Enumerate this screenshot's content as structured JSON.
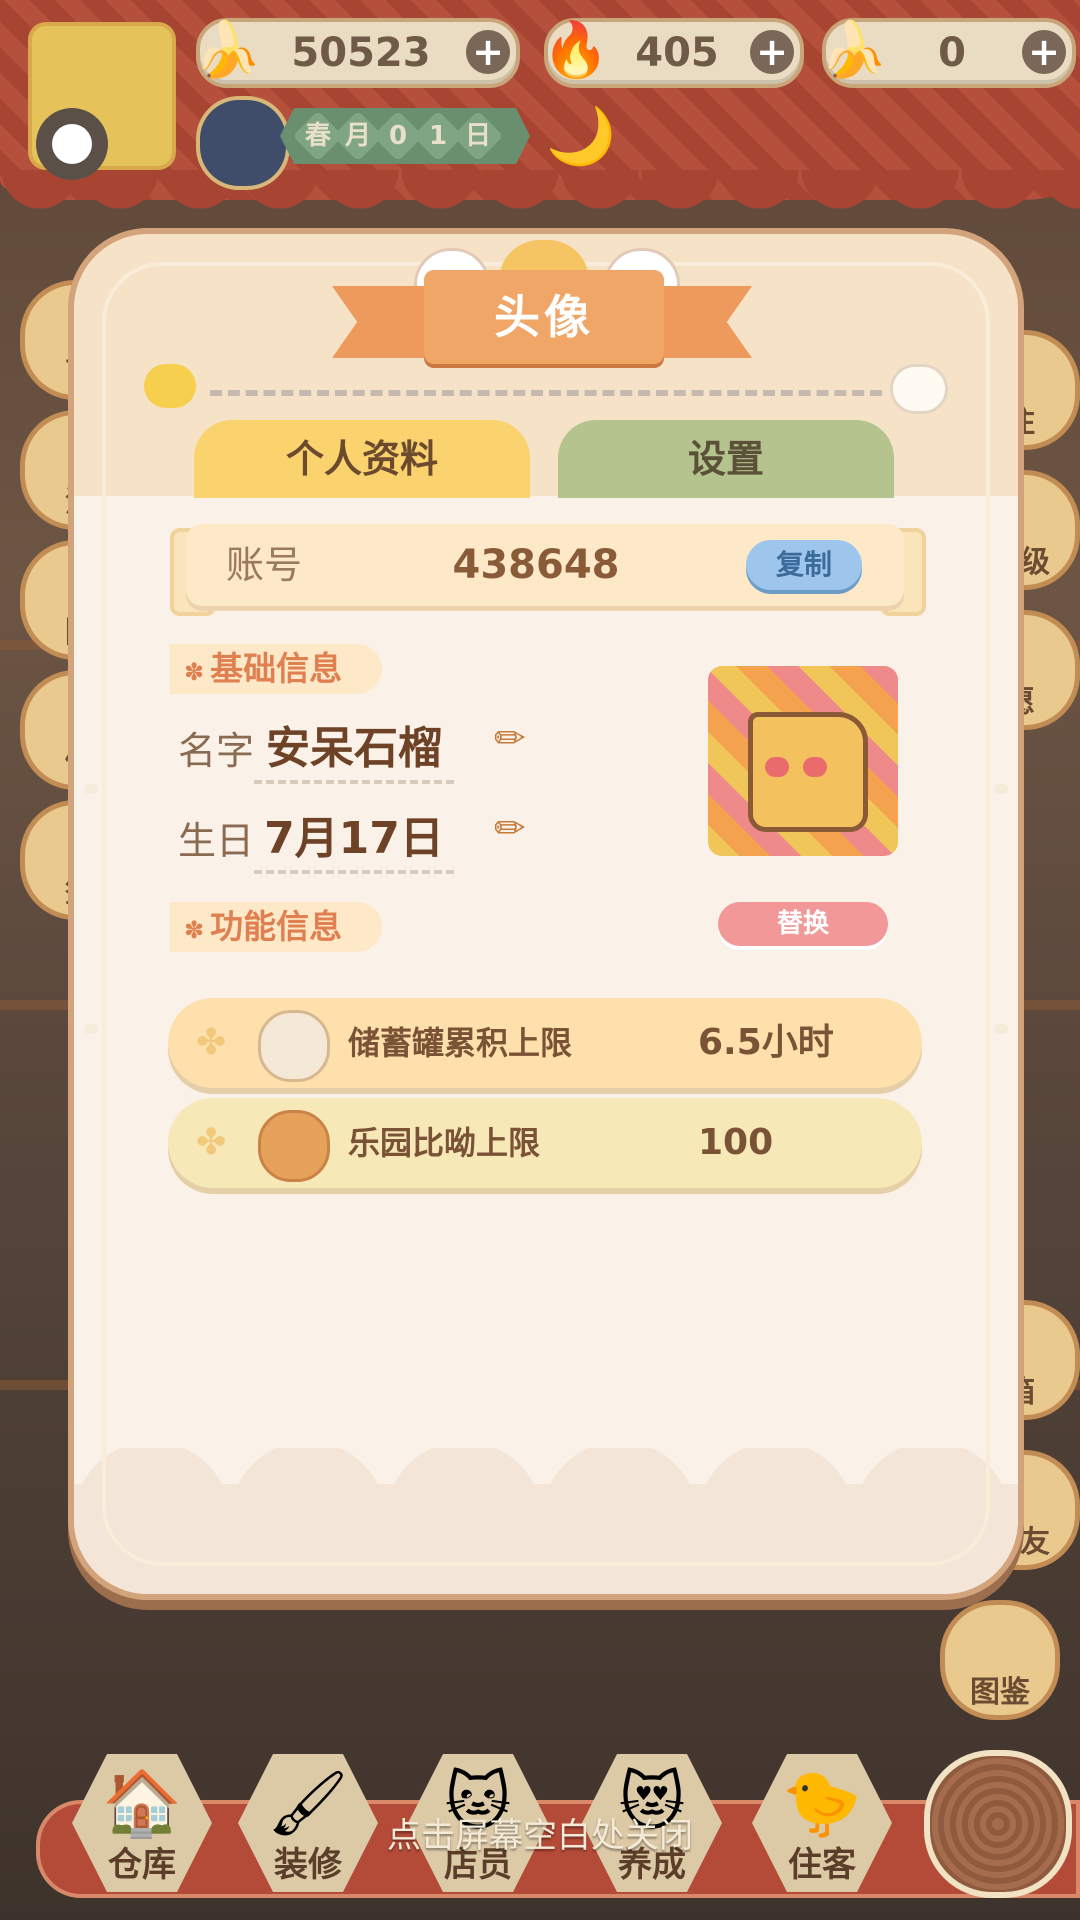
{
  "resources": [
    {
      "icon": "banana-icon",
      "value": "50523"
    },
    {
      "icon": "blue-flame-icon",
      "value": "405"
    },
    {
      "icon": "blue-banana-icon",
      "value": "0"
    }
  ],
  "date": {
    "chars": [
      "春",
      "月",
      "0",
      "1",
      "日"
    ]
  },
  "side_menu": {
    "left": [
      "商",
      "活",
      "附",
      "储",
      "签"
    ],
    "right": [
      "住",
      "等级",
      "愿",
      "箱",
      "好友",
      "图鉴"
    ]
  },
  "dialog": {
    "title": "头像",
    "tabs": {
      "profile": "个人资料",
      "settings": "设置"
    },
    "account": {
      "label": "账号",
      "value": "438648",
      "copy": "复制"
    },
    "basic_section": "基础信息",
    "name": {
      "label": "名字",
      "value": "安呆石榴"
    },
    "birthday": {
      "label": "生日",
      "value": "7月17日"
    },
    "replace": "替换",
    "func_section": "功能信息",
    "functions": [
      {
        "name": "储蓄罐累积上限",
        "value": "6.5小时"
      },
      {
        "name": "乐园比呦上限",
        "value": "100"
      }
    ]
  },
  "bottom_nav": [
    "仓库",
    "装修",
    "店员",
    "养成",
    "住客"
  ],
  "close_hint": "点击屏幕空白处关闭",
  "colors": {
    "accent": "#ed9a5c",
    "tab_active": "#fad36e",
    "tab_inactive": "#b5c38f",
    "copy_button": "#9ec6ec"
  }
}
